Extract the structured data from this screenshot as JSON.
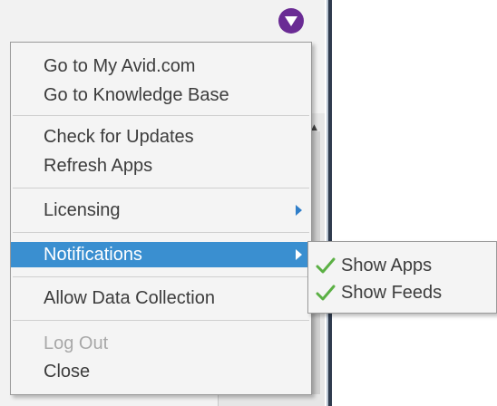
{
  "menu": {
    "sections": [
      {
        "items": [
          {
            "label": "Go to My Avid.com",
            "state": "normal"
          },
          {
            "label": "Go to Knowledge Base",
            "state": "normal"
          }
        ]
      },
      {
        "items": [
          {
            "label": "Check for Updates",
            "state": "normal"
          },
          {
            "label": "Refresh Apps",
            "state": "normal"
          }
        ]
      },
      {
        "items": [
          {
            "label": "Licensing",
            "state": "normal",
            "has_submenu": true
          }
        ]
      },
      {
        "items": [
          {
            "label": "Notifications",
            "state": "selected",
            "has_submenu": true
          }
        ]
      },
      {
        "items": [
          {
            "label": "Allow Data Collection",
            "state": "normal"
          }
        ]
      },
      {
        "items": [
          {
            "label": "Log Out",
            "state": "disabled"
          },
          {
            "label": "Close",
            "state": "normal"
          }
        ]
      }
    ]
  },
  "submenu": {
    "items": [
      {
        "label": "Show Apps",
        "checked": true
      },
      {
        "label": "Show Feeds",
        "checked": true
      }
    ]
  },
  "icons": {
    "menu_toggle": "chevron-down-icon",
    "check": "checkmark-icon",
    "submenu_arrow": "triangle-right-icon"
  },
  "colors": {
    "accent": "#3a8fd0",
    "toggle": "#6a2b94",
    "check": "#5bb044",
    "arrow": "#2f7ec9",
    "disabled_text": "#a8a8a8"
  }
}
